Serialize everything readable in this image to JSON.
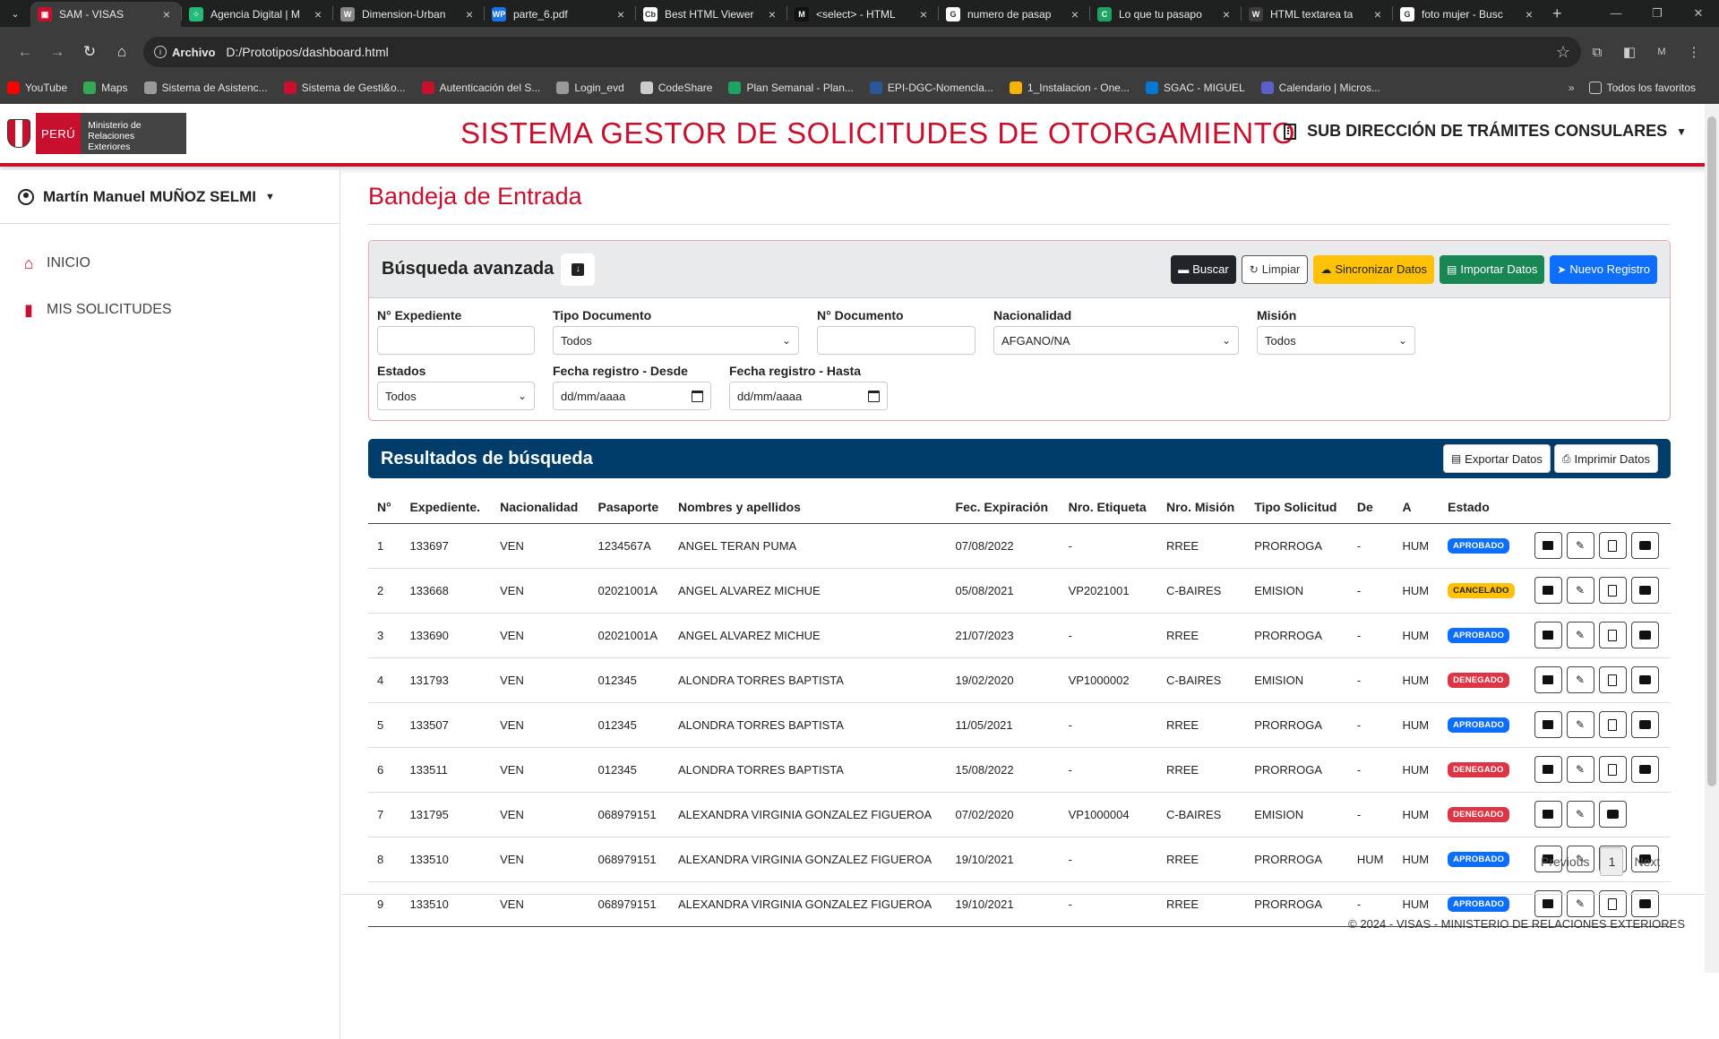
{
  "browser": {
    "tabs": [
      {
        "title": "SAM - VISAS",
        "fav": "#c8102e",
        "glyph": "▣",
        "active": true
      },
      {
        "title": "Agencia Digital | M",
        "fav": "#2b7",
        "glyph": "⁘",
        "active": false
      },
      {
        "title": "Dimension-Urban",
        "fav": "#888",
        "glyph": "W",
        "active": false
      },
      {
        "title": "parte_6.pdf",
        "fav": "#1a73e8",
        "glyph": "WP",
        "active": false
      },
      {
        "title": "Best HTML Viewer",
        "fav": "#fff",
        "glyph": "Cb",
        "active": false
      },
      {
        "title": "<select> - HTML",
        "fav": "#111",
        "glyph": "M",
        "active": false
      },
      {
        "title": "numero de pasap",
        "fav": "#fff",
        "glyph": "G",
        "active": false
      },
      {
        "title": "Lo que tu pasapo",
        "fav": "#1da462",
        "glyph": "C",
        "active": false
      },
      {
        "title": "HTML textarea ta",
        "fav": "#3c3c3c",
        "glyph": "W",
        "active": false
      },
      {
        "title": "foto mujer - Busc",
        "fav": "#fff",
        "glyph": "G",
        "active": false
      }
    ],
    "chip": "Archivo",
    "url": "D:/Prototipos/dashboard.html",
    "profile": "M",
    "bookmarks": [
      {
        "label": "YouTube",
        "color": "#f00"
      },
      {
        "label": "Maps",
        "color": "#34a853"
      },
      {
        "label": "Sistema de Asistenc...",
        "color": "#999"
      },
      {
        "label": "Sistema de Gesti&o...",
        "color": "#c8102e"
      },
      {
        "label": "Autenticación del S...",
        "color": "#c8102e"
      },
      {
        "label": "Login_evd",
        "color": "#999"
      },
      {
        "label": "CodeShare",
        "color": "#ccc"
      },
      {
        "label": "Plan Semanal - Plan...",
        "color": "#1da462"
      },
      {
        "label": "EPI-DGC-Nomencla...",
        "color": "#2b579a"
      },
      {
        "label": "1_Instalacion - One...",
        "color": "#f4b400"
      },
      {
        "label": "SGAC - MIGUEL",
        "color": "#0078d4"
      },
      {
        "label": "Calendario | Micros...",
        "color": "#5b5fc7"
      }
    ],
    "bookmarks_more": "»",
    "all_bookmarks": "Todos los favoritos"
  },
  "header": {
    "logo_peru": "PERÚ",
    "logo_ministry": "Ministerio de Relaciones Exteriores",
    "title": "SISTEMA GESTOR DE SOLICITUDES DE OTORGAMIENTO",
    "subdirection": "SUB DIRECCIÓN DE TRÁMITES CONSULARES"
  },
  "sidebar": {
    "user": "Martín Manuel MUÑOZ SELMI",
    "items": [
      {
        "label": "INICIO",
        "icon": "home-icon"
      },
      {
        "label": "MIS SOLICITUDES",
        "icon": "bookmark-icon"
      }
    ]
  },
  "main": {
    "page_title": "Bandeja de Entrada",
    "search": {
      "title": "Búsqueda avanzada",
      "buttons": {
        "buscar": "Buscar",
        "limpiar": "Limpiar",
        "sincronizar": "Sincronizar Datos",
        "importar": "Importar Datos",
        "nuevo": "Nuevo Registro"
      },
      "fields": {
        "expediente_label": "N° Expediente",
        "expediente_value": "",
        "tipo_doc_label": "Tipo Documento",
        "tipo_doc_value": "Todos",
        "nro_doc_label": "N° Documento",
        "nro_doc_value": "",
        "nacionalidad_label": "Nacionalidad",
        "nacionalidad_value": "AFGANO/NA",
        "mision_label": "Misión",
        "mision_value": "Todos",
        "estados_label": "Estados",
        "estados_value": "Todos",
        "desde_label": "Fecha registro - Desde",
        "desde_value": "dd/mm/aaaa",
        "hasta_label": "Fecha registro - Hasta",
        "hasta_value": "dd/mm/aaaa"
      }
    },
    "results": {
      "title": "Resultados de búsqueda",
      "export": "Exportar Datos",
      "print": "Imprimir Datos",
      "columns": [
        "N°",
        "Expediente.",
        "Nacionalidad",
        "Pasaporte",
        "Nombres y apellidos",
        "Fec. Expiración",
        "Nro. Etiqueta",
        "Nro. Misión",
        "Tipo Solicitud",
        "De",
        "A",
        "Estado"
      ],
      "rows": [
        {
          "n": "1",
          "exp": "133697",
          "nac": "VEN",
          "pas": "1234567A",
          "nom": "ANGEL TERAN PUMA",
          "fec": "07/08/2022",
          "eti": "-",
          "mis": "RREE",
          "tipo": "PRORROGA",
          "de": "-",
          "a": "HUM",
          "estado": "APROBADO",
          "st": "ap",
          "pdf": true
        },
        {
          "n": "2",
          "exp": "133668",
          "nac": "VEN",
          "pas": "02021001A",
          "nom": "ANGEL ALVAREZ MICHUE",
          "fec": "05/08/2021",
          "eti": "VP2021001",
          "mis": "C-BAIRES",
          "tipo": "EMISION",
          "de": "-",
          "a": "HUM",
          "estado": "CANCELADO",
          "st": "ca",
          "pdf": true
        },
        {
          "n": "3",
          "exp": "133690",
          "nac": "VEN",
          "pas": "02021001A",
          "nom": "ANGEL ALVAREZ MICHUE",
          "fec": "21/07/2023",
          "eti": "-",
          "mis": "RREE",
          "tipo": "PRORROGA",
          "de": "-",
          "a": "HUM",
          "estado": "APROBADO",
          "st": "ap",
          "pdf": true
        },
        {
          "n": "4",
          "exp": "131793",
          "nac": "VEN",
          "pas": "012345",
          "nom": "ALONDRA TORRES BAPTISTA",
          "fec": "19/02/2020",
          "eti": "VP1000002",
          "mis": "C-BAIRES",
          "tipo": "EMISION",
          "de": "-",
          "a": "HUM",
          "estado": "DENEGADO",
          "st": "de",
          "pdf": true
        },
        {
          "n": "5",
          "exp": "133507",
          "nac": "VEN",
          "pas": "012345",
          "nom": "ALONDRA TORRES BAPTISTA",
          "fec": "11/05/2021",
          "eti": "-",
          "mis": "RREE",
          "tipo": "PRORROGA",
          "de": "-",
          "a": "HUM",
          "estado": "APROBADO",
          "st": "ap",
          "pdf": true
        },
        {
          "n": "6",
          "exp": "133511",
          "nac": "VEN",
          "pas": "012345",
          "nom": "ALONDRA TORRES BAPTISTA",
          "fec": "15/08/2022",
          "eti": "-",
          "mis": "RREE",
          "tipo": "PRORROGA",
          "de": "-",
          "a": "HUM",
          "estado": "DENEGADO",
          "st": "de",
          "pdf": true
        },
        {
          "n": "7",
          "exp": "131795",
          "nac": "VEN",
          "pas": "068979151",
          "nom": "ALEXANDRA VIRGINIA GONZALEZ FIGUEROA",
          "fec": "07/02/2020",
          "eti": "VP1000004",
          "mis": "C-BAIRES",
          "tipo": "EMISION",
          "de": "-",
          "a": "HUM",
          "estado": "DENEGADO",
          "st": "de",
          "pdf": false
        },
        {
          "n": "8",
          "exp": "133510",
          "nac": "VEN",
          "pas": "068979151",
          "nom": "ALEXANDRA VIRGINIA GONZALEZ FIGUEROA",
          "fec": "19/10/2021",
          "eti": "-",
          "mis": "RREE",
          "tipo": "PRORROGA",
          "de": "HUM",
          "a": "HUM",
          "estado": "APROBADO",
          "st": "ap",
          "pdf": true
        },
        {
          "n": "9",
          "exp": "133510",
          "nac": "VEN",
          "pas": "068979151",
          "nom": "ALEXANDRA VIRGINIA GONZALEZ FIGUEROA",
          "fec": "19/10/2021",
          "eti": "-",
          "mis": "RREE",
          "tipo": "PRORROGA",
          "de": "-",
          "a": "HUM",
          "estado": "APROBADO",
          "st": "ap",
          "pdf": true
        }
      ]
    },
    "pagination": {
      "previous": "Previous",
      "current": "1",
      "next": "Next"
    },
    "footer": "© 2024 - VISAS - MINISTERIO DE RELACIONES EXTERIORES"
  }
}
